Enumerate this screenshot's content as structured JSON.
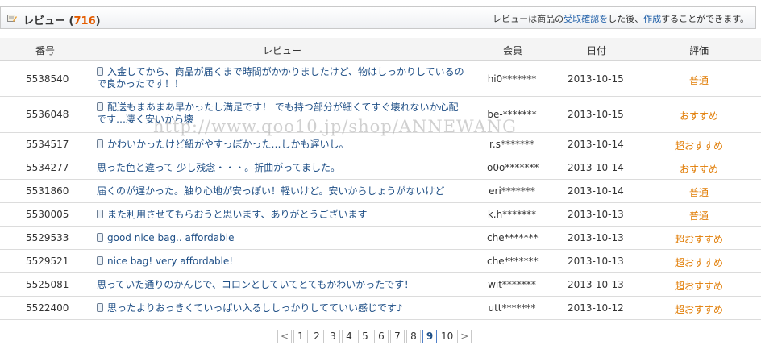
{
  "header": {
    "title": "レビュー",
    "count_open": "(",
    "count": "716",
    "count_close": ")",
    "note_prefix": "レビューは商品の",
    "note_link1": "受取確認を",
    "note_mid": "した後、",
    "note_link2": "作成",
    "note_suffix": "することができます。",
    "icon": "pencil-memo-icon"
  },
  "columns": {
    "num": "番号",
    "review": "レビュー",
    "member": "会員",
    "date": "日付",
    "rating": "評価"
  },
  "rows": [
    {
      "num": "5538540",
      "review": "入金してから、商品が届くまで時間がかかりましたけど、物はしっかりしているので良かったです！！",
      "member": "hi0*******",
      "date": "2013-10-15",
      "rating": "普通",
      "mobile": true
    },
    {
      "num": "5536048",
      "review": "配送もまあまあ早かったし満足です！ でも持つ部分が細くてすぐ壊れないか心配です…凄く安いから壊",
      "member": "be-*******",
      "date": "2013-10-15",
      "rating": "おすすめ",
      "mobile": true
    },
    {
      "num": "5534517",
      "review": "かわいかったけど紐がやすっぽかった…しかも遅いし。",
      "member": "r.s*******",
      "date": "2013-10-14",
      "rating": "超おすすめ",
      "mobile": true
    },
    {
      "num": "5534277",
      "review": "思った色と違って 少し残念・・・。折曲がってました。",
      "member": "o0o*******",
      "date": "2013-10-14",
      "rating": "おすすめ",
      "mobile": false
    },
    {
      "num": "5531860",
      "review": "届くのが遅かった。触り心地が安っぽい！軽いけど。安いからしょうがないけど",
      "member": "eri*******",
      "date": "2013-10-14",
      "rating": "普通",
      "mobile": false
    },
    {
      "num": "5530005",
      "review": "また利用させてもらおうと思います、ありがとうございます",
      "member": "k.h*******",
      "date": "2013-10-13",
      "rating": "普通",
      "mobile": true
    },
    {
      "num": "5529533",
      "review": "good nice bag.. affordable",
      "member": "che*******",
      "date": "2013-10-13",
      "rating": "超おすすめ",
      "mobile": true
    },
    {
      "num": "5529521",
      "review": "nice bag! very affordable!",
      "member": "che*******",
      "date": "2013-10-13",
      "rating": "超おすすめ",
      "mobile": true
    },
    {
      "num": "5525081",
      "review": "思っていた通りのかんじで、コロンとしていてとてもかわいかったです！",
      "member": "wit*******",
      "date": "2013-10-13",
      "rating": "超おすすめ",
      "mobile": false
    },
    {
      "num": "5522400",
      "review": "思ったよりおっきくていっぱい入るししっかりしてていい感じです♪",
      "member": "utt*******",
      "date": "2013-10-12",
      "rating": "超おすすめ",
      "mobile": true
    }
  ],
  "watermark": "http://www.qoo10.jp/shop/ANNEWANG",
  "pagination": {
    "prev": "<",
    "next": ">",
    "pages": [
      "1",
      "2",
      "3",
      "4",
      "5",
      "6",
      "7",
      "8",
      "9",
      "10"
    ],
    "current": "9"
  }
}
